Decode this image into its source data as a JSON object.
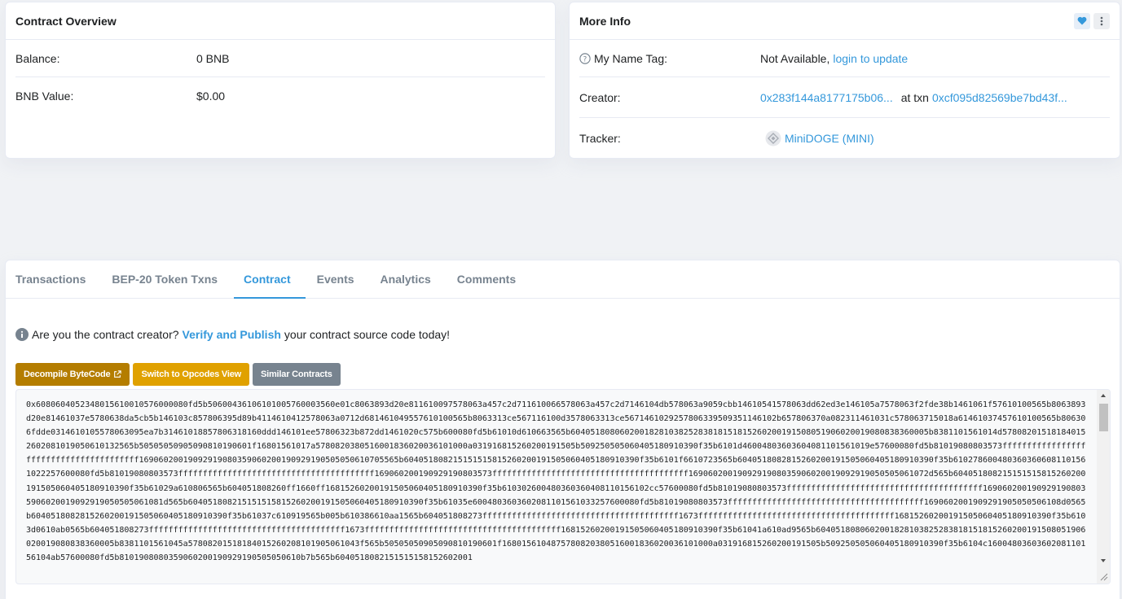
{
  "overview": {
    "title": "Contract Overview",
    "balance_label": "Balance:",
    "balance_value": "0 BNB",
    "value_label": "BNB Value:",
    "value_value": "$0.00"
  },
  "more_info": {
    "title": "More Info",
    "name_tag_label": "My Name Tag:",
    "name_tag_value": "Not Available,",
    "name_tag_link": "login to update",
    "creator_label": "Creator:",
    "creator_address": "0x283f144a8177175b06...",
    "at_txn_label": "at txn",
    "creator_txn": "0xcf095d82569be7bd43f...",
    "tracker_label": "Tracker:",
    "tracker_value": "MiniDOGE (MINI)"
  },
  "tabs": [
    {
      "label": "Transactions"
    },
    {
      "label": "BEP-20 Token Txns"
    },
    {
      "label": "Contract"
    },
    {
      "label": "Events"
    },
    {
      "label": "Analytics"
    },
    {
      "label": "Comments"
    }
  ],
  "contract": {
    "notice_prefix": "Are you the contract creator?",
    "notice_link": "Verify and Publish",
    "notice_suffix": "your contract source code today!",
    "decompile_label": "Decompile ByteCode",
    "opcodes_label": "Switch to Opcodes View",
    "similar_label": "Similar Contracts",
    "bytecode": "0x6080604052348015610010576000080fd5b5060043610610100576000356​0e01c8063893d20e811610097578063a457c2d711610066578063a457c2d7146104db578063a9059cbb14610541578063dd62ed3e146105a7578063f2fde38b1461061f57610100565b8063893d20e81461037e5780638da5cb5b146103c857806395d89b4114610412578063a0712d681461049557610100565b8063313ce567116100d3578063313ce567146102925780633950935114610​2b657806370a082311461031c578063715018a6146103745761010056​5b806306fdde0314610105578063095ea7b31461018857806318160ddd146101ee57806323b872dd1461020c575b600080fd5b61010d610663565b6040518080602001828103825283818151815260200191508051906020019080838360005b8381101561014d578082015181840152602081019050610132565b50505050905090810190601f1680156101​7a5780820380516001836020036101000a031916815260200191505b509250505060405180910390f35b6101d4600480360360408110156101​9e57600080fd5b81019080803573ffffffffffffffffffffffffffffffffffffffff169060200190929190803590602001909291905050506107055​65b604051808215151515815260200191505060405180910390f35b6101f6610723565b6040518082815260200191505060405180910390f35b610278600480360360608110156102225760008​0fd5b81019080803573ffffffffffffffffffffffffffffffffffffffff16906020019092919080357​3ffffffffffffffffffffffffffffffffffffffff1690602001909291908035906020019092919050505061072d565b604051808215151515815260200191505060405180910390f35b61029a610806565b604051808260ff1660ff16815260200191505060405180910390f35b61030260048036036040811015610​2cc57600080fd5b81019080803573ffffffffffffffffffffffffffffffffffffffff16906020019092919080359060200190929190505050610​81d565b604051808215151515815260200191505060405180910390f35b61035e600480360360208110156103325760008​0fd5b81019080803573ffffffffffffffffffffffffffffffffffffffff1690602001909291905050506108d0565b604051808281526020019150506040518091039​0f35b61037c610919565b005b610386610​aa1565b604051808273ffffffffffffffffffffffffffffffffffffffff1673ffffffffffffffffffffffffffffffffffffffff16815260200191505060405180910390f35b6103d0610ab0565b604051808273ffffffffffffffffffffffffffffffffffffffff1673ffffffffffffffffffffffffffffffffffffffff16815260200191505060405180910390f35b61041a610ad9565b6040518080602001828103825283818151815260200191508051906020019080838360005b8381101561045a578082015181840152602081019050610​43f565b50505050905090810190601f1680156104875780820380516001836020036101000a031916815260200191505b509250505060405180910390f35b6104c1600480360360208110156104ab57600080fd5b8101908080359060200190929190505050610b7b565b6040518082151515158152602001"
  },
  "colors": {
    "link": "#3498db",
    "decompile_bg": "#b47d00",
    "opcodes_bg": "#e0a100",
    "similar_bg": "#77838f"
  }
}
